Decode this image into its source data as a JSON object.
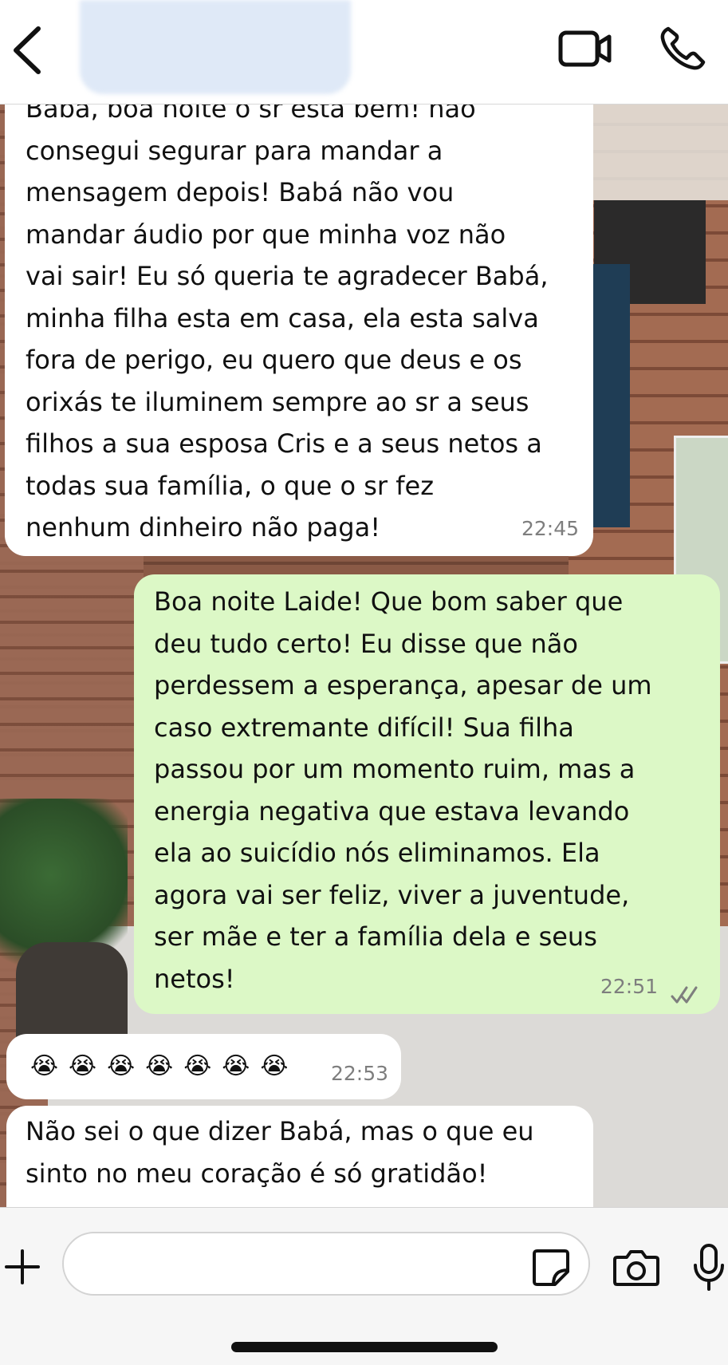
{
  "header": {
    "contact_name": "",
    "icons": {
      "back": "chevron-left-icon",
      "video": "video-camera-icon",
      "call": "phone-icon"
    }
  },
  "messages": [
    {
      "direction": "incoming",
      "lines": [
        "Babá, boa noite o sr esta bem! não",
        "consegui segurar para mandar a",
        "mensagem depois! Babá não vou",
        "mandar áudio por que minha voz não",
        "vai sair! Eu só queria te agradecer Babá,",
        "minha filha esta em casa, ela esta salva",
        "fora de perigo, eu quero que deus e os",
        "orixás te iluminem sempre ao sr a seus",
        "filhos a sua esposa Cris e a seus netos a",
        "todas sua família, o que o sr fez",
        "nenhum dinheiro não paga!"
      ],
      "time": "22:45"
    },
    {
      "direction": "outgoing",
      "lines": [
        "Boa noite Laide! Que bom saber que",
        "deu tudo certo! Eu disse que não",
        "perdessem a esperança, apesar de um",
        "caso extremante difícil! Sua filha",
        "passou por um momento ruim, mas a",
        "energia negativa que estava levando",
        "ela ao suicídio nós eliminamos. Ela",
        "agora vai ser feliz, viver a juventude,",
        "ser mãe e ter a família dela e seus",
        "netos!"
      ],
      "time": "22:51",
      "status": "read"
    },
    {
      "direction": "incoming",
      "text": "😭😭😭😭😭😭😭",
      "time": "22:53"
    },
    {
      "direction": "incoming",
      "lines": [
        "Não sei o que dizer Babá, mas o que eu",
        "sinto no meu coração é só gratidão!"
      ]
    }
  ],
  "composer": {
    "placeholder": "",
    "icons": {
      "add": "plus-icon",
      "sticker": "sticker-icon",
      "camera": "camera-icon",
      "mic": "microphone-icon"
    }
  },
  "colors": {
    "incoming_bubble": "#ffffff",
    "outgoing_bubble": "#dcf8c6",
    "read_ticks": "#7e7e7e"
  }
}
